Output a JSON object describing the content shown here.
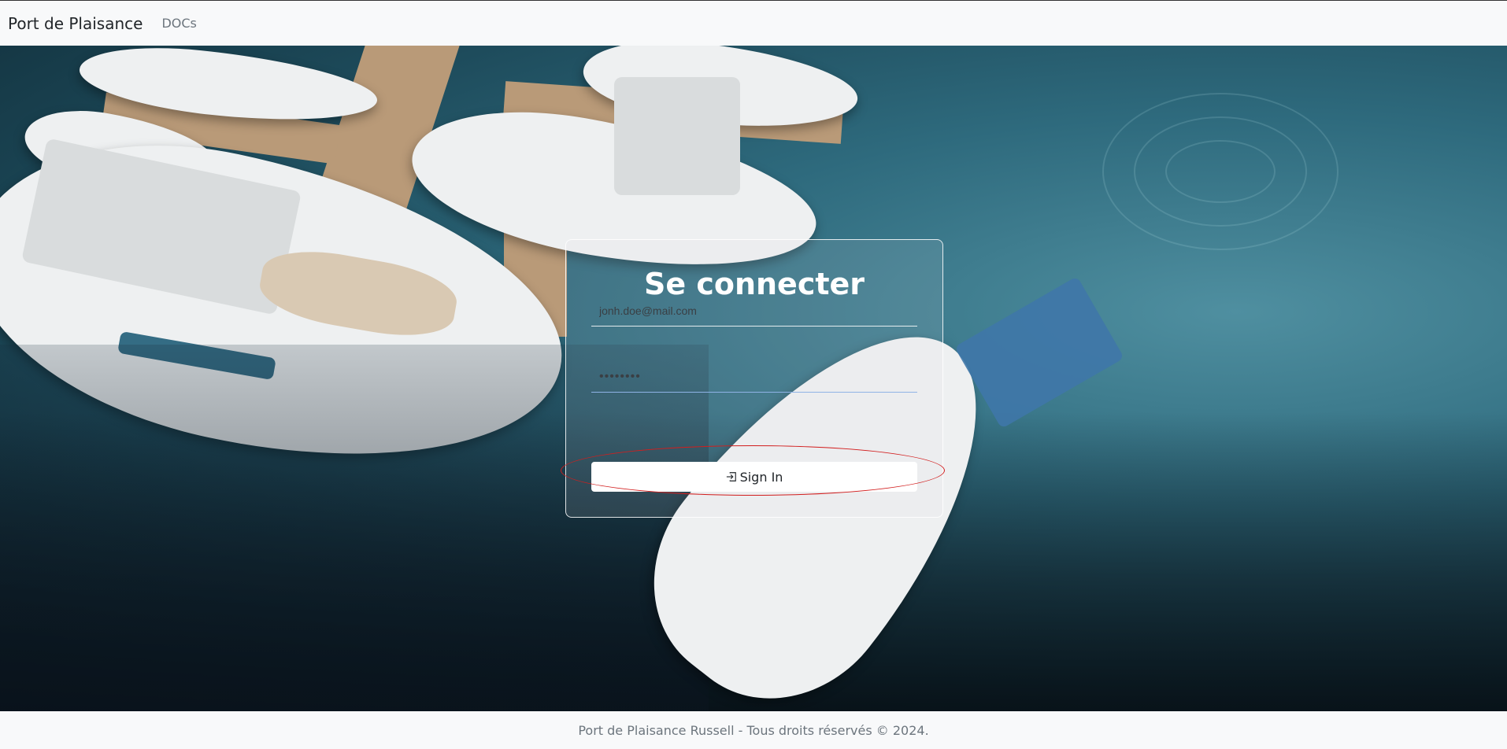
{
  "navbar": {
    "brand": "Port de Plaisance",
    "links": [
      "DOCs"
    ]
  },
  "login": {
    "title": "Se connecter",
    "email_value": "jonh.doe@mail.com",
    "password_value": "••••••••",
    "button_label": "Sign In",
    "button_icon": "login-icon"
  },
  "footer": {
    "text": "Port de Plaisance Russell - Tous droits réservés © 2024."
  },
  "colors": {
    "highlight": "#d21e1e",
    "card_border": "#ffffff",
    "water": "#2e6a7d"
  }
}
